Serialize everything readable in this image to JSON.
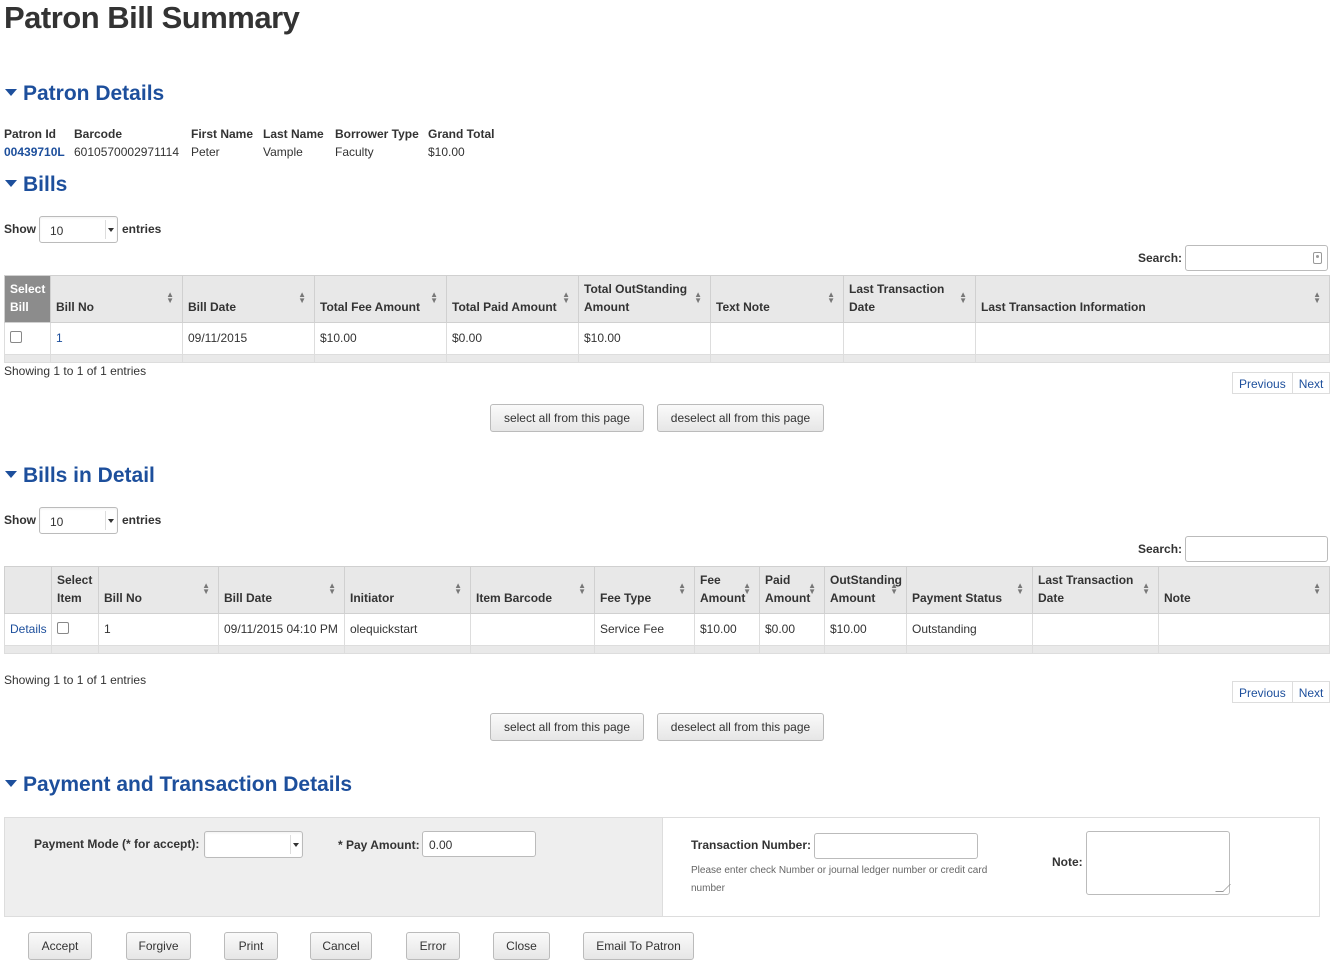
{
  "page_title": "Patron Bill Summary",
  "sections": {
    "patron": "Patron Details",
    "bills": "Bills",
    "bills_detail": "Bills in Detail",
    "payment": "Payment and Transaction Details"
  },
  "patron": {
    "headers": [
      "Patron Id",
      "Barcode",
      "First Name",
      "Last Name",
      "Borrower Type",
      "Grand Total"
    ],
    "values": [
      "00439710L",
      "6010570002971114",
      "Peter",
      "Vample",
      "Faculty",
      "$10.00"
    ]
  },
  "bills": {
    "show_label": "Show",
    "entries_label": "entries",
    "page_size": "10",
    "search_label": "Search:",
    "columns": [
      "Select Bill",
      "Bill No",
      "Bill Date",
      "Total Fee Amount",
      "Total Paid Amount",
      "Total OutStanding Amount",
      "Text Note",
      "Last Transaction Date",
      "Last Transaction Information"
    ],
    "rows": [
      {
        "bill_no": "1",
        "bill_date": "09/11/2015",
        "total_fee": "$10.00",
        "total_paid": "$0.00",
        "total_outstanding": "$10.00",
        "text_note": "",
        "last_txn_date": "",
        "last_txn_info": ""
      }
    ],
    "info": "Showing 1 to 1 of 1 entries",
    "prev": "Previous",
    "next": "Next",
    "select_all": "select all from this page",
    "deselect_all": "deselect all from this page"
  },
  "bills_detail": {
    "show_label": "Show",
    "entries_label": "entries",
    "page_size": "10",
    "search_label": "Search:",
    "columns": [
      "",
      "Select Item",
      "Bill No",
      "Bill Date",
      "Initiator",
      "Item Barcode",
      "Fee Type",
      "Fee Amount",
      "Paid Amount",
      "OutStanding Amount",
      "Payment Status",
      "Last Transaction Date",
      "Note"
    ],
    "rows": [
      {
        "details": "Details",
        "bill_no": "1",
        "bill_date": "09/11/2015 04:10 PM",
        "initiator": "olequickstart",
        "item_barcode": "",
        "fee_type": "Service Fee",
        "fee_amount": "$10.00",
        "paid_amount": "$0.00",
        "outstanding": "$10.00",
        "status": "Outstanding",
        "last_txn_date": "",
        "note": ""
      }
    ],
    "info": "Showing 1 to 1 of 1 entries",
    "prev": "Previous",
    "next": "Next",
    "select_all": "select all from this page",
    "deselect_all": "deselect all from this page"
  },
  "payment": {
    "mode_label": "Payment Mode (* for accept):",
    "mode_value": "",
    "amount_label": "* Pay Amount:",
    "amount_value": "0.00",
    "txn_label": "Transaction Number:",
    "txn_value": "",
    "txn_hint": "Please enter check Number or journal ledger number or credit card number",
    "note_label": "Note:",
    "note_value": ""
  },
  "actions": [
    "Accept",
    "Forgive",
    "Print",
    "Cancel",
    "Error",
    "Close",
    "Email To Patron"
  ]
}
